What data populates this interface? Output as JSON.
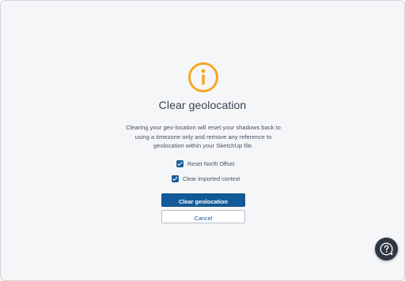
{
  "dialog": {
    "title": "Clear geolocation",
    "description": "Clearing your geo-location will reset your shadows back to using a timezone only and remove any reference to geolocation within your SketchUp file.",
    "options": [
      {
        "label": "Reset North Offset",
        "checked": true
      },
      {
        "label": "Clear imported context",
        "checked": true
      }
    ],
    "primary_label": "Clear geolocation",
    "secondary_label": "Cancel",
    "icon": "info-icon"
  },
  "help": {
    "icon": "question-help-icon"
  },
  "colors": {
    "accent": "#115a99",
    "info_icon": "#f5a623",
    "background": "#f5f6f8",
    "help_button": "#2f3644"
  }
}
